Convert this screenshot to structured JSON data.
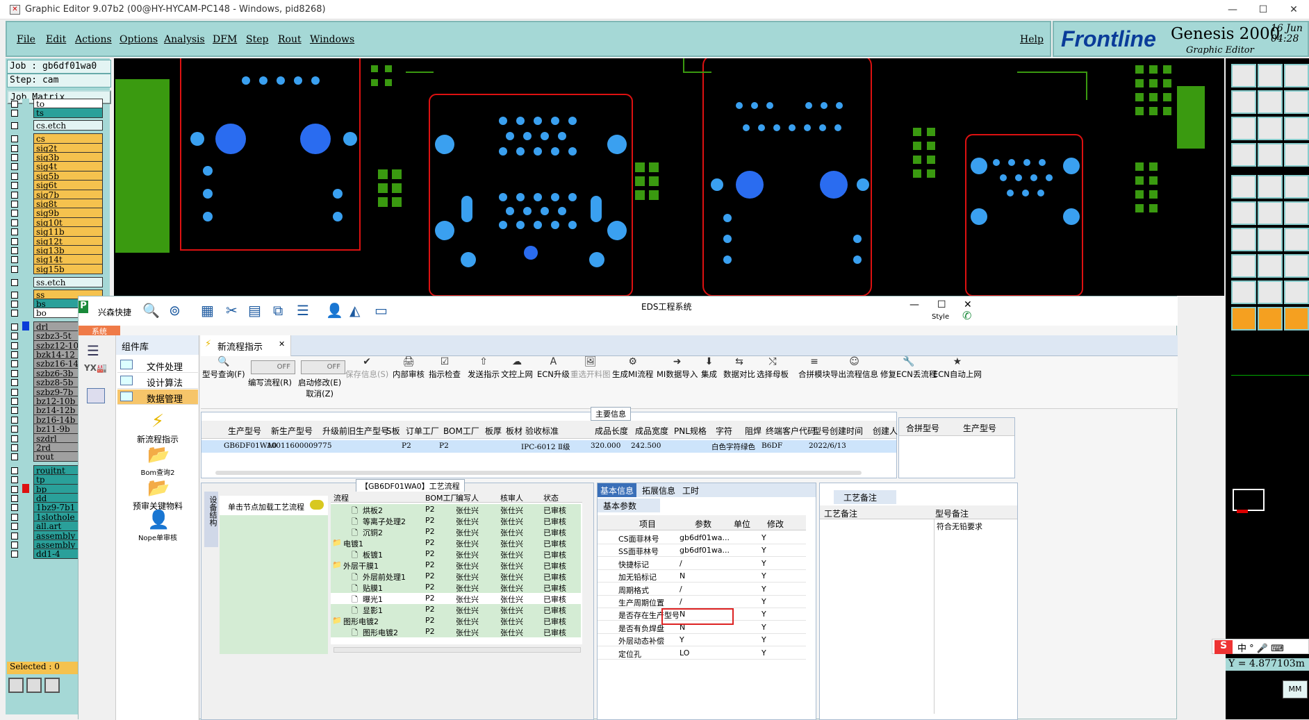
{
  "window": {
    "title": "Graphic Editor 9.07b2 (00@HY-HYCAM-PC148 - Windows, pid8268)"
  },
  "genesis_menu": [
    "File",
    "Edit",
    "Actions",
    "Options",
    "Analysis",
    "DFM",
    "Step",
    "Rout",
    "Windows"
  ],
  "help": "Help",
  "brand": {
    "logo": "Frontline",
    "product": "Genesis 2000",
    "sub": "Graphic Editor",
    "date": "16 Jun",
    "time": "04:28"
  },
  "job": {
    "job": "Job : gb6df01wa0",
    "step": "Step: cam",
    "matrix": "Job Matrix ..."
  },
  "layers": [
    {
      "name": "to",
      "color": "#ffffff"
    },
    {
      "name": "ts",
      "color": "#2aa09a"
    },
    {
      "name": "cs.etch",
      "color": "#e3f4f3"
    },
    {
      "name": "cs",
      "color": "#f5c24e"
    },
    {
      "name": "sig2t",
      "color": "#f5c24e"
    },
    {
      "name": "sig3b",
      "color": "#f5c24e"
    },
    {
      "name": "sig4t",
      "color": "#f5c24e"
    },
    {
      "name": "sig5b",
      "color": "#f5c24e"
    },
    {
      "name": "sig6t",
      "color": "#f5c24e"
    },
    {
      "name": "sig7b",
      "color": "#f5c24e"
    },
    {
      "name": "sig8t",
      "color": "#f5c24e"
    },
    {
      "name": "sig9b",
      "color": "#f5c24e"
    },
    {
      "name": "sig10t",
      "color": "#f5c24e"
    },
    {
      "name": "sig11b",
      "color": "#f5c24e"
    },
    {
      "name": "sig12t",
      "color": "#f5c24e"
    },
    {
      "name": "sig13b",
      "color": "#f5c24e"
    },
    {
      "name": "sig14t",
      "color": "#f5c24e"
    },
    {
      "name": "sig15b",
      "color": "#f5c24e"
    },
    {
      "name": "ss.etch",
      "color": "#e3f4f3"
    },
    {
      "name": "ss",
      "color": "#f5c24e"
    },
    {
      "name": "bs",
      "color": "#2aa09a"
    },
    {
      "name": "bo",
      "color": "#ffffff"
    },
    {
      "name": "drl",
      "color": "#a0a0a0"
    },
    {
      "name": "szbz3-5t",
      "color": "#a0a0a0"
    },
    {
      "name": "szbz12-10",
      "color": "#a0a0a0"
    },
    {
      "name": "bzk14-12",
      "color": "#a0a0a0"
    },
    {
      "name": "szbz16-14",
      "color": "#a0a0a0"
    },
    {
      "name": "szbz6-3b",
      "color": "#a0a0a0"
    },
    {
      "name": "szbz8-5b",
      "color": "#a0a0a0"
    },
    {
      "name": "szbz9-7b",
      "color": "#a0a0a0"
    },
    {
      "name": "bz12-10b",
      "color": "#a0a0a0"
    },
    {
      "name": "bz14-12b",
      "color": "#a0a0a0"
    },
    {
      "name": "bz16-14b",
      "color": "#a0a0a0"
    },
    {
      "name": "bz11-9b",
      "color": "#a0a0a0"
    },
    {
      "name": "szdrl",
      "color": "#a0a0a0"
    },
    {
      "name": "2rd",
      "color": "#a0a0a0"
    },
    {
      "name": "rout",
      "color": "#a0a0a0"
    },
    {
      "name": "roujtnt",
      "color": "#2aa09a"
    },
    {
      "name": "tp",
      "color": "#2aa09a"
    },
    {
      "name": "bp",
      "color": "#2aa09a"
    },
    {
      "name": "dd",
      "color": "#2aa09a"
    },
    {
      "name": "1bz9-7b1",
      "color": "#2aa09a"
    },
    {
      "name": "1slothole",
      "color": "#2aa09a"
    },
    {
      "name": "all.art",
      "color": "#2aa09a"
    },
    {
      "name": "assembly",
      "color": "#2aa09a"
    },
    {
      "name": "assembly",
      "color": "#2aa09a"
    },
    {
      "name": "dd1-4",
      "color": "#2aa09a"
    }
  ],
  "selected": "Selected : 0",
  "coord": "Y = 4.877103m",
  "mm": "MM",
  "eds": {
    "title": "EDS工程系统",
    "brand": "兴森快捷",
    "system_tab": "系统",
    "style": "Style",
    "comp_header": "组件库",
    "nav": [
      "文件处理",
      "设计算法",
      "数据管理"
    ],
    "quick": [
      "新流程指示",
      "Bom查询2",
      "预审关键物料",
      "Nope单审核"
    ],
    "tab": "新流程指示",
    "toggle_off": "OFF",
    "ribbon": [
      {
        "label": "型号查询(F)",
        "dis": false
      },
      {
        "label": "编写流程(R)",
        "dis": false
      },
      {
        "label": "启动修改(E)",
        "sub": "取消(Z)",
        "dis": false
      },
      {
        "label": "保存信息(S)",
        "dis": true
      },
      {
        "label": "内部审核",
        "dis": false
      },
      {
        "label": "指示检查",
        "dis": false
      },
      {
        "label": "发送指示",
        "dis": false
      },
      {
        "label": "文控上网",
        "dis": false
      },
      {
        "label": "ECN升级",
        "dis": false
      },
      {
        "label": "重选开料图",
        "dis": true
      },
      {
        "label": "生成MI流程",
        "dis": false
      },
      {
        "label": "MI数据导入",
        "dis": false
      },
      {
        "label": "集成",
        "dis": false
      },
      {
        "label": "数据对比",
        "dis": false
      },
      {
        "label": "选择母板",
        "dis": false
      },
      {
        "label": "合拼模块",
        "dis": false
      },
      {
        "label": "导出流程信息",
        "dis": false
      },
      {
        "label": "修复ECN丢流程",
        "dis": false
      },
      {
        "label": "ECN自动上网",
        "dis": false
      }
    ],
    "main_caption": "主要信息",
    "main_cols": [
      "生产型号",
      "新生产型号",
      "升级前旧生产型号",
      "S板",
      "订单工厂",
      "BOM工厂",
      "板厚",
      "板材",
      "验收标准",
      "成品长度",
      "成品宽度",
      "PNL规格",
      "字符",
      "阻焊",
      "终端客户代码",
      "型号创建时间",
      "创建人"
    ],
    "main_row": [
      "GB6DF01WA0",
      "10011600009775",
      "",
      "",
      "P2",
      "P2",
      "",
      "",
      "IPC-6012 Ⅱ级",
      "320.000",
      "242.500",
      "",
      "白色字符",
      "绿色",
      "B6DF",
      "2022/6/13",
      ""
    ],
    "merge_cols": [
      "合拼型号",
      "生产型号"
    ],
    "flow_caption": "【GB6DF01WA0】工艺流程",
    "flow_side": "设备结构",
    "flow_hint": "单击节点加载工艺流程",
    "tree_cols": [
      "流程",
      "BOM工厂",
      "编写人",
      "核审人",
      "状态"
    ],
    "tree": [
      {
        "name": "烘板2",
        "f": "P2",
        "w": "张仕兴",
        "r": "张仕兴",
        "s": "已审核",
        "lvl": 2
      },
      {
        "name": "等离子处理2",
        "f": "P2",
        "w": "张仕兴",
        "r": "张仕兴",
        "s": "已审核",
        "lvl": 2
      },
      {
        "name": "沉铜2",
        "f": "P2",
        "w": "张仕兴",
        "r": "张仕兴",
        "s": "已审核",
        "lvl": 2
      },
      {
        "name": "电镀1",
        "f": "P2",
        "w": "张仕兴",
        "r": "张仕兴",
        "s": "已审核",
        "lvl": 1
      },
      {
        "name": "板镀1",
        "f": "P2",
        "w": "张仕兴",
        "r": "张仕兴",
        "s": "已审核",
        "lvl": 2
      },
      {
        "name": "外层干膜1",
        "f": "P2",
        "w": "张仕兴",
        "r": "张仕兴",
        "s": "已审核",
        "lvl": 1
      },
      {
        "name": "外层前处理1",
        "f": "P2",
        "w": "张仕兴",
        "r": "张仕兴",
        "s": "已审核",
        "lvl": 2
      },
      {
        "name": "贴膜1",
        "f": "P2",
        "w": "张仕兴",
        "r": "张仕兴",
        "s": "已审核",
        "lvl": 2
      },
      {
        "name": "曝光1",
        "f": "P2",
        "w": "张仕兴",
        "r": "张仕兴",
        "s": "已审核",
        "lvl": 2
      },
      {
        "name": "显影1",
        "f": "P2",
        "w": "张仕兴",
        "r": "张仕兴",
        "s": "已审核",
        "lvl": 2
      },
      {
        "name": "图形电镀2",
        "f": "P2",
        "w": "张仕兴",
        "r": "张仕兴",
        "s": "已审核",
        "lvl": 1
      },
      {
        "name": "图形电镀2",
        "f": "P2",
        "w": "张仕兴",
        "r": "张仕兴",
        "s": "已审核",
        "lvl": 2
      }
    ],
    "info_tabs": [
      "基本信息",
      "拓展信息",
      "工时"
    ],
    "basic_params": "基本参数",
    "prop_cols": [
      "项目",
      "参数",
      "单位",
      "修改"
    ],
    "props": [
      {
        "k": "CS面菲林号",
        "v": "gb6df01wa...",
        "u": "",
        "m": "Y"
      },
      {
        "k": "SS面菲林号",
        "v": "gb6df01wa...",
        "u": "",
        "m": "Y"
      },
      {
        "k": "快捷标记",
        "v": "/",
        "u": "",
        "m": "Y"
      },
      {
        "k": "加无铅标记",
        "v": "N",
        "u": "",
        "m": "Y"
      },
      {
        "k": "周期格式",
        "v": "/",
        "u": "",
        "m": "Y"
      },
      {
        "k": "生产周期位置",
        "v": "/",
        "u": "",
        "m": "Y"
      },
      {
        "k": "是否存在生产型号",
        "v": "N",
        "u": "",
        "m": "Y"
      },
      {
        "k": "是否有负焊盘",
        "v": "N",
        "u": "",
        "m": "Y"
      },
      {
        "k": "外层动态补偿",
        "v": "Y",
        "u": "",
        "m": "Y"
      },
      {
        "k": "定位孔",
        "v": "LO",
        "u": "",
        "m": "Y"
      }
    ],
    "craft_tab": "工艺备注",
    "craft_cols": [
      "工艺备注",
      "型号备注"
    ],
    "craft_note": "符合无铅要求"
  },
  "ime": "中"
}
